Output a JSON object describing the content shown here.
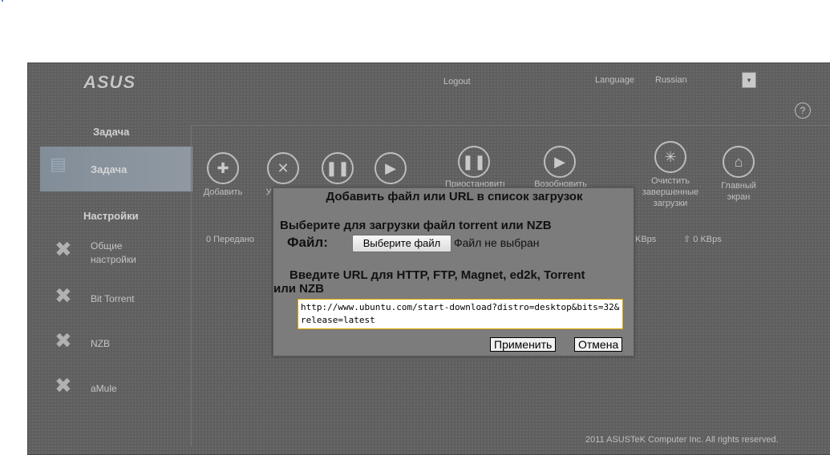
{
  "header": {
    "logo": "ASUS",
    "logout": "Logout",
    "language_label": "Language",
    "language_value": "Russian",
    "help_glyph": "?"
  },
  "sidebar": {
    "task_heading": "Задача",
    "task_item": "Задача",
    "settings_heading": "Настройки",
    "items": [
      {
        "label_line1": "Общие",
        "label_line2": "настройки"
      },
      {
        "label_line1": "Bit Torrent"
      },
      {
        "label_line1": "NZB"
      },
      {
        "label_line1": "aMule"
      }
    ]
  },
  "toolbar": {
    "add_label": "Добавить",
    "delete_label": "У",
    "pause_label": "",
    "start_label": "",
    "pause_all_label": "Приостановить",
    "resume_all_label": "Возобновить",
    "clear_label_1": "Очистить",
    "clear_label_2": "завершенные",
    "clear_label_3": "загрузки",
    "home_label_1": "Главный",
    "home_label_2": "экран"
  },
  "stats": {
    "transferred": "0 Передано",
    "down_speed": "KBps",
    "up_speed": "0 KBps"
  },
  "footer": {
    "copyright": "2011 ASUSTeK Computer Inc. All rights reserved."
  },
  "dialog": {
    "title": "Добавить файл или URL в список загрузок",
    "file_prompt": "Выберите для загрузки файл torrent или NZB",
    "file_label": "Файл:",
    "file_button": "Выберите файл",
    "file_status": "Файл не выбран",
    "url_prompt_line1": "Введите URL для HTTP, FTP, Magnet, ed2k, Torrent",
    "url_prompt_line2": "или NZB",
    "url_value": "http://www.ubuntu.com/start-download?distro=desktop&bits=32&release=latest",
    "apply_button": "Применить",
    "cancel_button": "Отмена"
  },
  "colors": {
    "background": "#4a4a4a",
    "dialog": "#7c7c7c",
    "url_border": "#e0a800"
  }
}
